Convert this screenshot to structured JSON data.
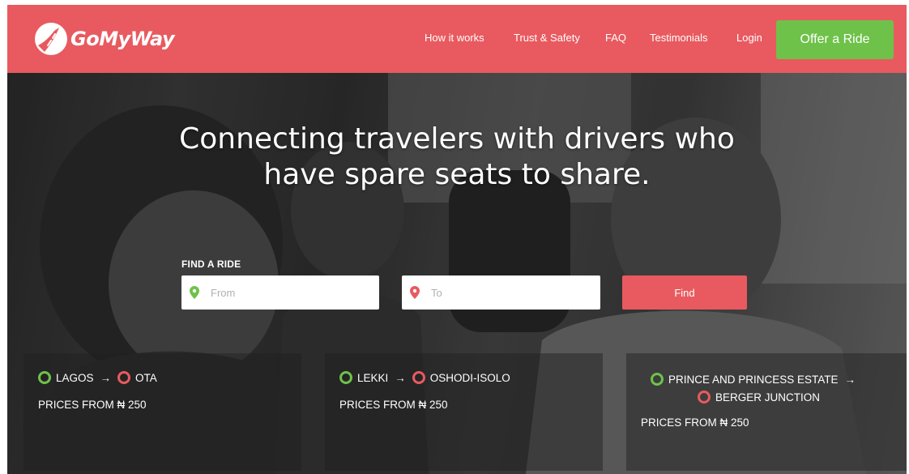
{
  "brand": {
    "name": "GoMyWay"
  },
  "colors": {
    "brand_red": "#e85a5f",
    "cta_green": "#6ec249",
    "ring_green": "#6ec249",
    "ring_red": "#e85a5f"
  },
  "nav": {
    "links": [
      "How it works",
      "Trust & Safety",
      "FAQ",
      "Testimonials",
      "Login"
    ],
    "cta": "Offer a Ride"
  },
  "hero": {
    "headline_line1": "Connecting travelers with drivers who",
    "headline_line2": "have spare seats to share."
  },
  "search": {
    "label": "FIND A RIDE",
    "from_placeholder": "From",
    "to_placeholder": "To",
    "button": "Find",
    "from_icon": "map-pin-icon",
    "to_icon": "map-pin-icon"
  },
  "routes": [
    {
      "from": "LAGOS",
      "to": "OTA",
      "arrow": "→",
      "price": "PRICES FROM ₦ 250"
    },
    {
      "from": "LEKKI",
      "to": "OSHODI-ISOLO",
      "arrow": "→",
      "price": "PRICES FROM ₦ 250"
    },
    {
      "from": "PRINCE AND PRINCESS ESTATE",
      "to": "BERGER JUNCTION",
      "arrow": "→",
      "price": "PRICES FROM ₦ 250"
    }
  ]
}
